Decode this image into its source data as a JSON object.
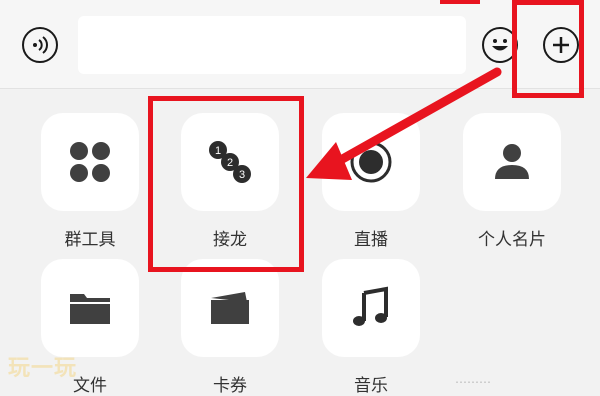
{
  "topbar": {
    "input_value": ""
  },
  "apps": [
    {
      "label": "群工具",
      "icon": "grid-icon"
    },
    {
      "label": "接龙",
      "icon": "chain-123-icon"
    },
    {
      "label": "直播",
      "icon": "record-icon"
    },
    {
      "label": "个人名片",
      "icon": "person-icon"
    },
    {
      "label": "文件",
      "icon": "folder-icon"
    },
    {
      "label": "卡券",
      "icon": "card-icon"
    },
    {
      "label": "音乐",
      "icon": "music-icon"
    }
  ],
  "chain_numbers": [
    "1",
    "2",
    "3"
  ],
  "annotation_color": "#e8141f",
  "watermark": "玩一玩",
  "footnote": "………"
}
